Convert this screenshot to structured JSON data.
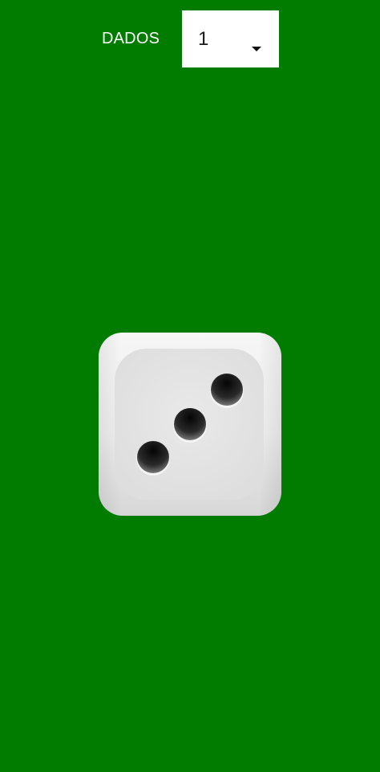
{
  "header": {
    "label": "DADOS"
  },
  "dice_count_select": {
    "value": "1"
  },
  "die": {
    "face_value": 3
  },
  "colors": {
    "background": "#017c00",
    "select_background": "#ffffff",
    "die_face": "#e6e6e6",
    "pip": "#111111"
  }
}
